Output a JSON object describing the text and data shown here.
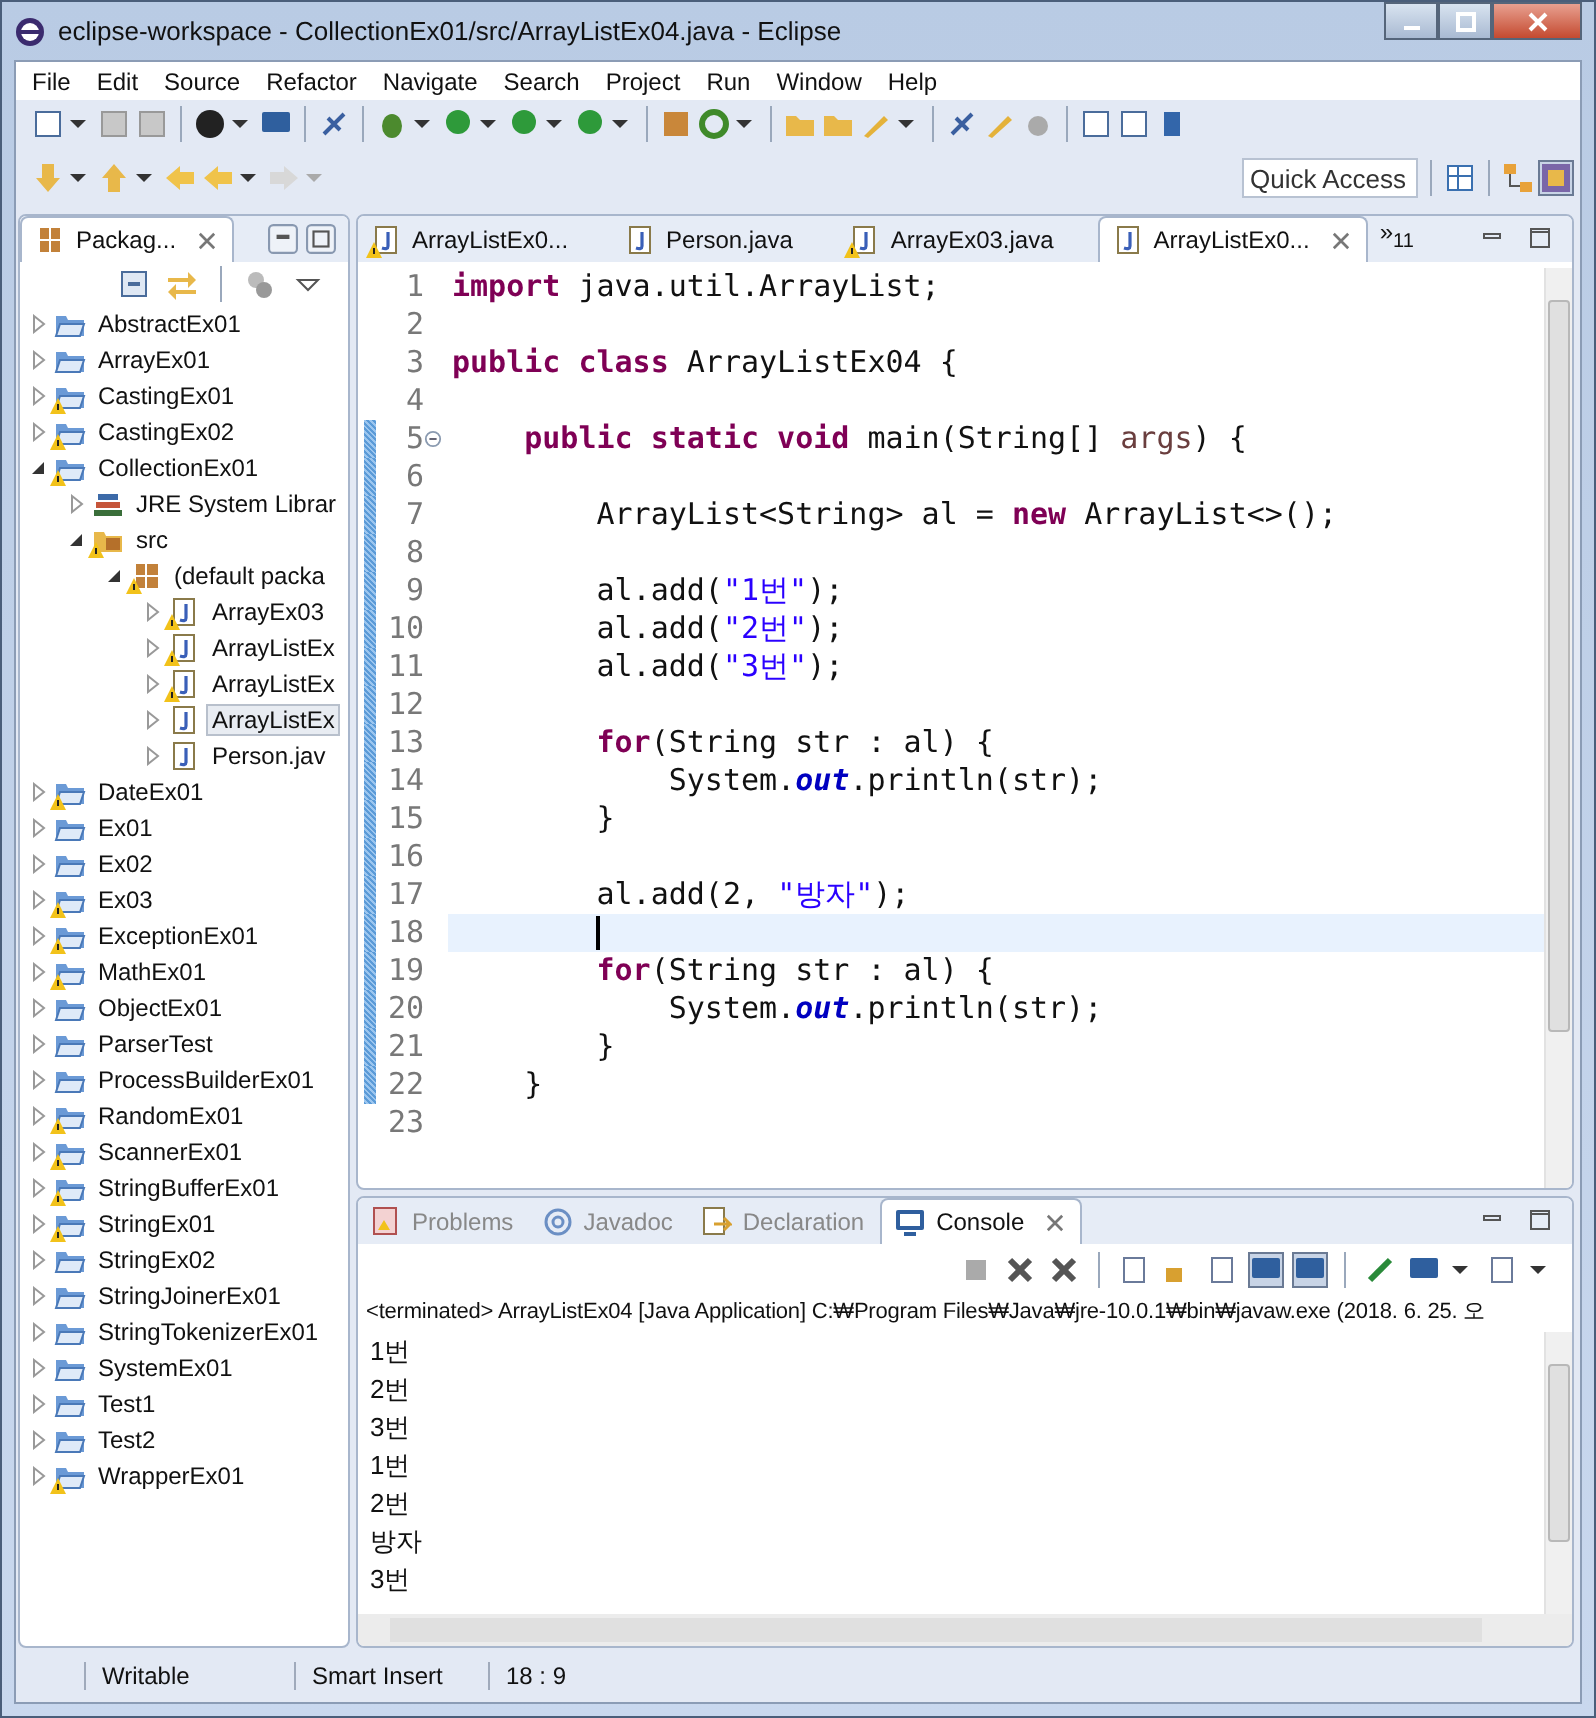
{
  "window": {
    "title": "eclipse-workspace - CollectionEx01/src/ArrayListEx04.java - Eclipse"
  },
  "menu": [
    "File",
    "Edit",
    "Source",
    "Refactor",
    "Navigate",
    "Search",
    "Project",
    "Run",
    "Window",
    "Help"
  ],
  "quick_access": {
    "placeholder": "Quick Access"
  },
  "package_explorer": {
    "title": "Packag...",
    "tree": [
      {
        "label": "AbstractEx01",
        "kind": "project",
        "warning": false,
        "expanded": false,
        "selected": false
      },
      {
        "label": "ArrayEx01",
        "kind": "project",
        "warning": false,
        "expanded": false,
        "selected": false
      },
      {
        "label": "CastingEx01",
        "kind": "project",
        "warning": true,
        "expanded": false,
        "selected": false
      },
      {
        "label": "CastingEx02",
        "kind": "project",
        "warning": true,
        "expanded": false,
        "selected": false
      },
      {
        "label": "CollectionEx01",
        "kind": "project",
        "warning": true,
        "expanded": true,
        "selected": false,
        "children": [
          {
            "label": "JRE System Librar",
            "kind": "library",
            "warning": false,
            "expanded": false,
            "selected": false
          },
          {
            "label": "src",
            "kind": "folder",
            "warning": true,
            "expanded": true,
            "selected": false,
            "children": [
              {
                "label": "(default packa",
                "kind": "package",
                "warning": true,
                "expanded": true,
                "selected": false,
                "children": [
                  {
                    "label": "ArrayEx03",
                    "kind": "java",
                    "warning": true,
                    "expanded": false,
                    "selected": false
                  },
                  {
                    "label": "ArrayListEx",
                    "kind": "java",
                    "warning": true,
                    "expanded": false,
                    "selected": false
                  },
                  {
                    "label": "ArrayListEx",
                    "kind": "java",
                    "warning": true,
                    "expanded": false,
                    "selected": false
                  },
                  {
                    "label": "ArrayListEx",
                    "kind": "java",
                    "warning": false,
                    "expanded": false,
                    "selected": true
                  },
                  {
                    "label": "Person.jav",
                    "kind": "java",
                    "warning": false,
                    "expanded": false,
                    "selected": false
                  }
                ]
              }
            ]
          }
        ]
      },
      {
        "label": "DateEx01",
        "kind": "project",
        "warning": true,
        "expanded": false,
        "selected": false
      },
      {
        "label": "Ex01",
        "kind": "project",
        "warning": false,
        "expanded": false,
        "selected": false
      },
      {
        "label": "Ex02",
        "kind": "project",
        "warning": false,
        "expanded": false,
        "selected": false
      },
      {
        "label": "Ex03",
        "kind": "project",
        "warning": true,
        "expanded": false,
        "selected": false
      },
      {
        "label": "ExceptionEx01",
        "kind": "project",
        "warning": true,
        "expanded": false,
        "selected": false
      },
      {
        "label": "MathEx01",
        "kind": "project",
        "warning": true,
        "expanded": false,
        "selected": false
      },
      {
        "label": "ObjectEx01",
        "kind": "project",
        "warning": false,
        "expanded": false,
        "selected": false
      },
      {
        "label": "ParserTest",
        "kind": "project",
        "warning": false,
        "expanded": false,
        "selected": false
      },
      {
        "label": "ProcessBuilderEx01",
        "kind": "project",
        "warning": false,
        "expanded": false,
        "selected": false
      },
      {
        "label": "RandomEx01",
        "kind": "project",
        "warning": true,
        "expanded": false,
        "selected": false
      },
      {
        "label": "ScannerEx01",
        "kind": "project",
        "warning": true,
        "expanded": false,
        "selected": false
      },
      {
        "label": "StringBufferEx01",
        "kind": "project",
        "warning": true,
        "expanded": false,
        "selected": false
      },
      {
        "label": "StringEx01",
        "kind": "project",
        "warning": true,
        "expanded": false,
        "selected": false
      },
      {
        "label": "StringEx02",
        "kind": "project",
        "warning": false,
        "expanded": false,
        "selected": false
      },
      {
        "label": "StringJoinerEx01",
        "kind": "project",
        "warning": false,
        "expanded": false,
        "selected": false
      },
      {
        "label": "StringTokenizerEx01",
        "kind": "project",
        "warning": false,
        "expanded": false,
        "selected": false
      },
      {
        "label": "SystemEx01",
        "kind": "project",
        "warning": false,
        "expanded": false,
        "selected": false
      },
      {
        "label": "Test1",
        "kind": "project",
        "warning": false,
        "expanded": false,
        "selected": false
      },
      {
        "label": "Test2",
        "kind": "project",
        "warning": false,
        "expanded": false,
        "selected": false
      },
      {
        "label": "WrapperEx01",
        "kind": "project",
        "warning": true,
        "expanded": false,
        "selected": false
      }
    ]
  },
  "editor": {
    "tabs": [
      {
        "label": "ArrayListEx0...",
        "warning": true,
        "selected": false
      },
      {
        "label": "Person.java",
        "warning": false,
        "selected": false
      },
      {
        "label": "ArrayEx03.java",
        "warning": true,
        "selected": false
      },
      {
        "label": "ArrayListEx0...",
        "warning": false,
        "selected": true
      }
    ],
    "overflow": "»$_{11}$",
    "lines": [
      {
        "number": "1",
        "changed": false,
        "current": false,
        "fold": false,
        "tokens": [
          {
            "t": "import",
            "kind": "keyword"
          },
          {
            "t": " java.util.ArrayList;",
            "kind": "plain"
          }
        ]
      },
      {
        "number": "2",
        "changed": false,
        "current": false,
        "fold": false
      },
      {
        "number": "3",
        "changed": false,
        "current": false,
        "fold": false,
        "tokens": [
          {
            "t": "public class",
            "kind": "keyword"
          },
          {
            "t": " ArrayListEx04 {",
            "kind": "plain"
          }
        ]
      },
      {
        "number": "4",
        "changed": false,
        "current": false,
        "fold": false
      },
      {
        "number": "5",
        "changed": true,
        "current": false,
        "fold": true,
        "tokens": [
          {
            "t": "    public static void",
            "kind": "keyword"
          },
          {
            "t": " main(String[] ",
            "kind": "plain"
          },
          {
            "t": "args",
            "kind": "parameter"
          },
          {
            "t": ") {",
            "kind": "plain"
          }
        ]
      },
      {
        "number": "6",
        "changed": true,
        "current": false,
        "fold": false
      },
      {
        "number": "7",
        "changed": true,
        "current": false,
        "fold": false,
        "tokens": [
          {
            "t": "        ArrayList<String> al = ",
            "kind": "plain"
          },
          {
            "t": "new",
            "kind": "keyword"
          },
          {
            "t": " ArrayList<>();",
            "kind": "plain"
          }
        ]
      },
      {
        "number": "8",
        "changed": true,
        "current": false,
        "fold": false
      },
      {
        "number": "9",
        "changed": true,
        "current": false,
        "fold": false,
        "tokens": [
          {
            "t": "        al.add(",
            "kind": "plain"
          },
          {
            "t": "\"1번\"",
            "kind": "string"
          },
          {
            "t": ");",
            "kind": "plain"
          }
        ]
      },
      {
        "number": "10",
        "changed": true,
        "current": false,
        "fold": false,
        "tokens": [
          {
            "t": "        al.add(",
            "kind": "plain"
          },
          {
            "t": "\"2번\"",
            "kind": "string"
          },
          {
            "t": ");",
            "kind": "plain"
          }
        ]
      },
      {
        "number": "11",
        "changed": true,
        "current": false,
        "fold": false,
        "tokens": [
          {
            "t": "        al.add(",
            "kind": "plain"
          },
          {
            "t": "\"3번\"",
            "kind": "string"
          },
          {
            "t": ");",
            "kind": "plain"
          }
        ]
      },
      {
        "number": "12",
        "changed": true,
        "current": false,
        "fold": false
      },
      {
        "number": "13",
        "changed": true,
        "current": false,
        "fold": false,
        "tokens": [
          {
            "t": "        for",
            "kind": "keyword"
          },
          {
            "t": "(String str : al) {",
            "kind": "plain"
          }
        ]
      },
      {
        "number": "14",
        "changed": true,
        "current": false,
        "fold": false,
        "tokens": [
          {
            "t": "            System.",
            "kind": "plain"
          },
          {
            "t": "out",
            "kind": "field"
          },
          {
            "t": ".println(str);",
            "kind": "plain"
          }
        ]
      },
      {
        "number": "15",
        "changed": true,
        "current": false,
        "fold": false,
        "tokens": [
          {
            "t": "        }",
            "kind": "plain"
          }
        ]
      },
      {
        "number": "16",
        "changed": true,
        "current": false,
        "fold": false
      },
      {
        "number": "17",
        "changed": true,
        "current": false,
        "fold": false,
        "tokens": [
          {
            "t": "        al.add(2, ",
            "kind": "plain"
          },
          {
            "t": "\"방자\"",
            "kind": "string"
          },
          {
            "t": ");",
            "kind": "plain"
          }
        ]
      },
      {
        "number": "18",
        "changed": true,
        "current": true,
        "fold": false
      },
      {
        "number": "19",
        "changed": true,
        "current": false,
        "fold": false,
        "tokens": [
          {
            "t": "        for",
            "kind": "keyword"
          },
          {
            "t": "(String str : al) {",
            "kind": "plain"
          }
        ]
      },
      {
        "number": "20",
        "changed": true,
        "current": false,
        "fold": false,
        "tokens": [
          {
            "t": "            System.",
            "kind": "plain"
          },
          {
            "t": "out",
            "kind": "field"
          },
          {
            "t": ".println(str);",
            "kind": "plain"
          }
        ]
      },
      {
        "number": "21",
        "changed": true,
        "current": false,
        "fold": false,
        "tokens": [
          {
            "t": "        }",
            "kind": "plain"
          }
        ]
      },
      {
        "number": "22",
        "changed": true,
        "current": false,
        "fold": false,
        "tokens": [
          {
            "t": "    }",
            "kind": "plain"
          }
        ]
      },
      {
        "number": "23",
        "changed": false,
        "current": false,
        "fold": false
      }
    ]
  },
  "console": {
    "tabs": [
      {
        "label": "Problems",
        "selected": false
      },
      {
        "label": "Javadoc",
        "selected": false
      },
      {
        "label": "Declaration",
        "selected": false
      },
      {
        "label": "Console",
        "selected": true
      }
    ],
    "header": "<terminated> ArrayListEx04 [Java Application] C:₩Program Files₩Java₩jre-10.0.1₩bin₩javaw.exe (2018. 6. 25. 오",
    "output": [
      "1번",
      "2번",
      "3번",
      "1번",
      "2번",
      "방자",
      "3번"
    ]
  },
  "status_bar": [
    "Writable",
    "Smart Insert",
    "18 : 9"
  ]
}
